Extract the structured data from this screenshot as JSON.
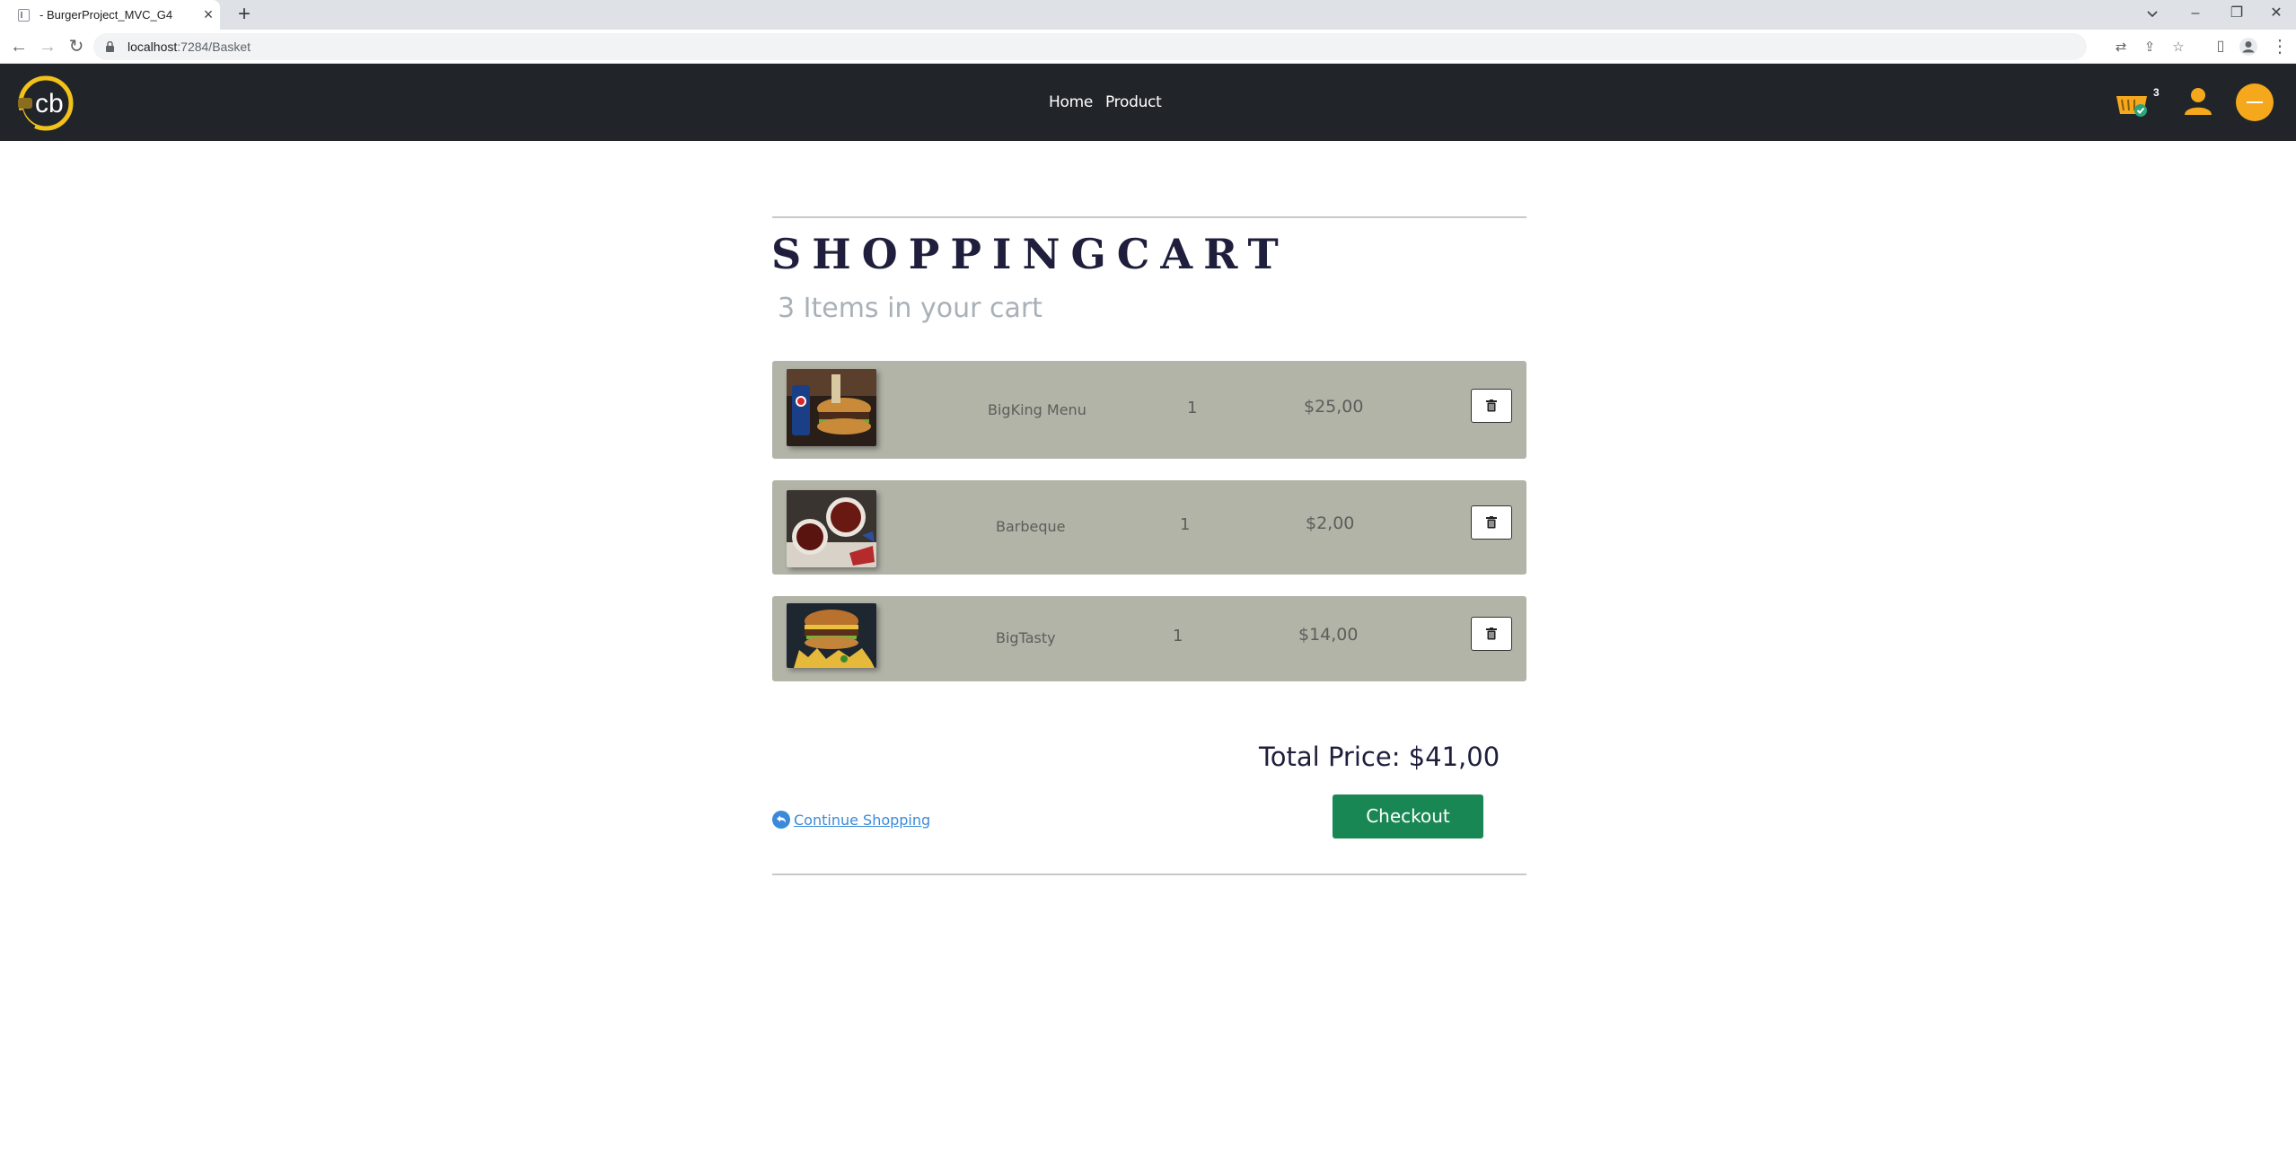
{
  "browser": {
    "tab_title": "- BurgerProject_MVC_G4",
    "tab_close": "×",
    "new_tab": "+",
    "url_host": "localhost",
    "url_path": ":7284/Basket",
    "window_controls": {
      "minimize": "–",
      "restore": "❐",
      "close": "✕"
    }
  },
  "navbar": {
    "logo_text": "cb",
    "menu": [
      {
        "label": "Home"
      },
      {
        "label": "Product"
      }
    ],
    "cart_badge_count": "3",
    "accent_color": "#f5a81c",
    "background_color": "#212529"
  },
  "cart": {
    "heading": "SHOPPINGCART",
    "subheading": "3 Items in your cart",
    "items": [
      {
        "name": "BigKing Menu",
        "qty": "1",
        "price": "$25,00",
        "image": "burger-menu-with-drink"
      },
      {
        "name": "Barbeque",
        "qty": "1",
        "price": "$2,00",
        "image": "barbeque-sauce-bowls"
      },
      {
        "name": "BigTasty",
        "qty": "1",
        "price": "$14,00",
        "image": "burger-with-fries"
      }
    ],
    "total_label": "Total Price: $41,00",
    "continue_label": "Continue Shopping",
    "checkout_label": "Checkout",
    "checkout_color": "#198754",
    "row_color": "#b2b4a8"
  }
}
